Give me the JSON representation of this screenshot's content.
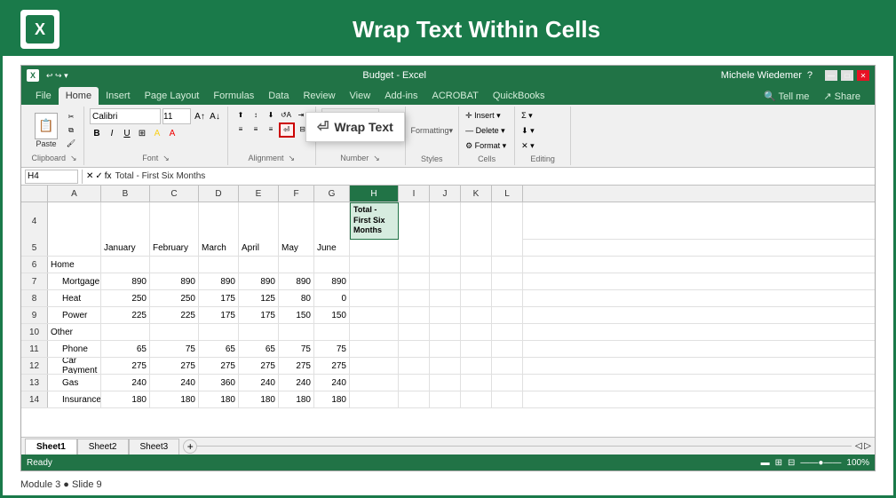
{
  "header": {
    "title": "Wrap Text Within Cells",
    "logo_text": "X"
  },
  "titlebar": {
    "filename": "Budget - Excel",
    "user": "Michele Wiedemer",
    "undo": "↩ ↪ ▼"
  },
  "ribbon": {
    "tabs": [
      "File",
      "Home",
      "Insert",
      "Page Layout",
      "Formulas",
      "Data",
      "Review",
      "View",
      "Add-ins",
      "ACROBAT",
      "QuickBooks"
    ],
    "active_tab": "Home",
    "tell_me": "Tell me",
    "share": "Share",
    "font": "Calibri",
    "font_size": "11",
    "groups": [
      "Clipboard",
      "Font",
      "Alignment",
      "Number",
      "Styles",
      "Cells",
      "Editing"
    ],
    "wrap_text_label": "Wrap Text"
  },
  "formula_bar": {
    "name_box": "H4",
    "formula": "Total - First Six Months"
  },
  "columns": [
    "A",
    "B",
    "C",
    "D",
    "E",
    "F",
    "G",
    "H",
    "I",
    "J",
    "K",
    "L"
  ],
  "column_headers": {
    "selected": "H"
  },
  "rows": [
    {
      "num": "4",
      "cells": {
        "H": {
          "text": "Total -\nFirst Six\nMonths",
          "selected": true
        }
      }
    },
    {
      "num": "5",
      "cells": {
        "B": "January",
        "C": "February",
        "D": "March",
        "E": "April",
        "F": "May",
        "G": "June"
      }
    },
    {
      "num": "6",
      "cells": {
        "A": "Home"
      }
    },
    {
      "num": "7",
      "cells": {
        "A": "Mortgage",
        "B": "890",
        "C": "890",
        "D": "890",
        "E": "890",
        "F": "890",
        "G": "890"
      },
      "indent": true
    },
    {
      "num": "8",
      "cells": {
        "A": "Heat",
        "B": "250",
        "C": "250",
        "D": "175",
        "E": "125",
        "F": "80",
        "G": "0"
      },
      "indent": true
    },
    {
      "num": "9",
      "cells": {
        "A": "Power",
        "B": "225",
        "C": "225",
        "D": "175",
        "E": "175",
        "F": "150",
        "G": "150"
      },
      "indent": true
    },
    {
      "num": "10",
      "cells": {
        "A": "Other"
      }
    },
    {
      "num": "11",
      "cells": {
        "A": "Phone",
        "B": "65",
        "C": "75",
        "D": "65",
        "E": "65",
        "F": "75",
        "G": "75"
      },
      "indent": true
    },
    {
      "num": "12",
      "cells": {
        "A": "Car Payment",
        "B": "275",
        "C": "275",
        "D": "275",
        "E": "275",
        "F": "275",
        "G": "275"
      },
      "indent": true
    },
    {
      "num": "13",
      "cells": {
        "A": "Gas",
        "B": "240",
        "C": "240",
        "D": "360",
        "E": "240",
        "F": "240",
        "G": "240"
      },
      "indent": true
    },
    {
      "num": "14",
      "cells": {
        "A": "Insurance",
        "B": "180",
        "C": "180",
        "D": "180",
        "E": "180",
        "F": "180",
        "G": "180"
      },
      "indent": true
    }
  ],
  "sheets": [
    "Sheet1",
    "Sheet2",
    "Sheet3"
  ],
  "active_sheet": "Sheet1",
  "status": "Ready",
  "zoom": "100%",
  "footer": {
    "text": "Module 3 ● Slide 9"
  },
  "callout": {
    "label": "Wrap Text"
  },
  "colors": {
    "green": "#217346",
    "dark_green": "#1a7a4a",
    "header_selected": "#d6ecdf",
    "red_border": "#cc0000"
  }
}
